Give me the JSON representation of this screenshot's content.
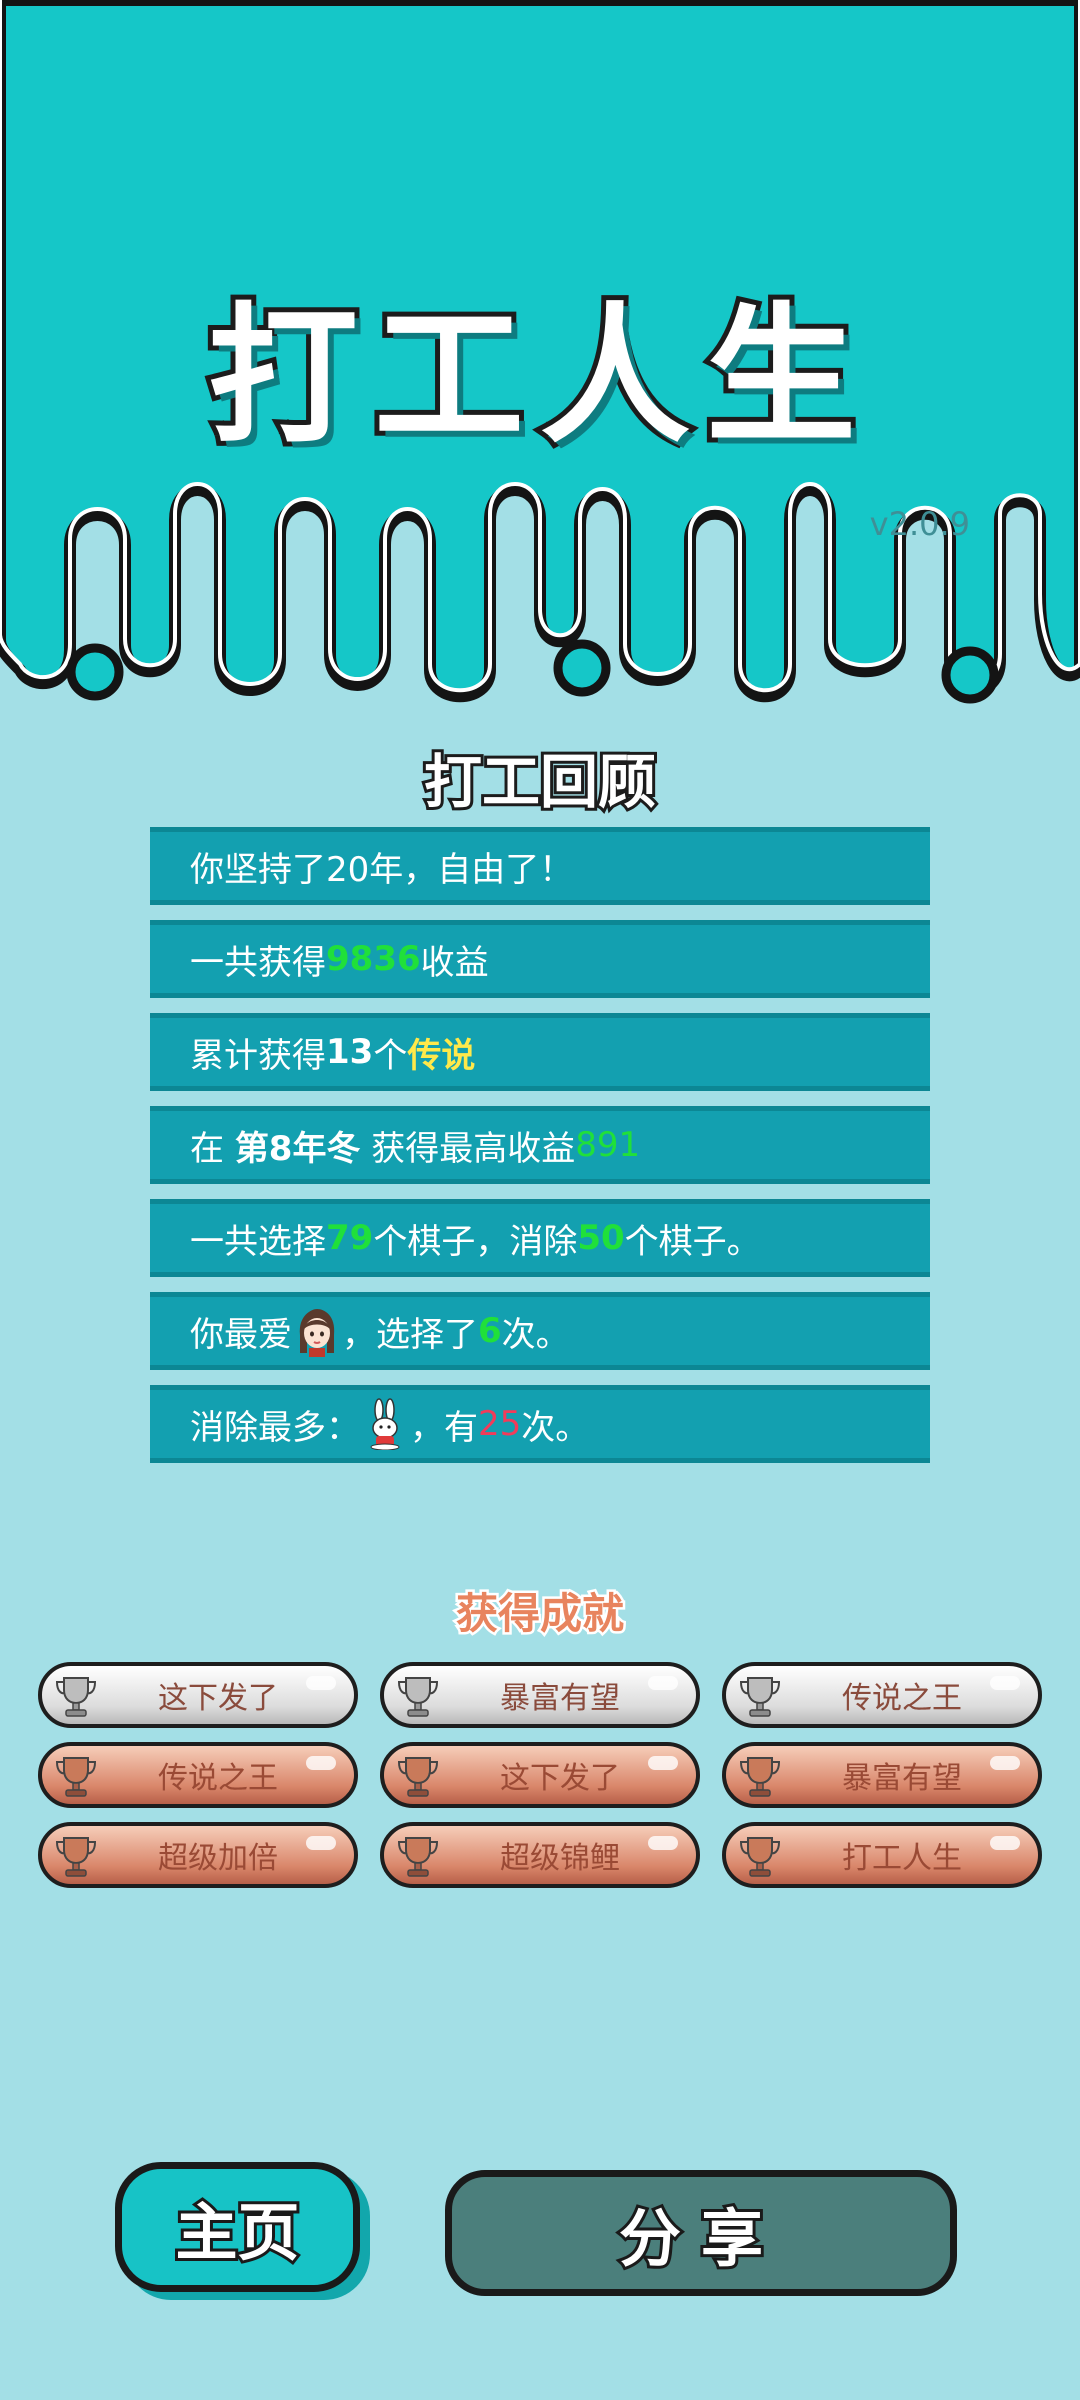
{
  "header": {
    "title": "打工人生",
    "version": "v2.0.9"
  },
  "review": {
    "title": "打工回顾",
    "rows": [
      {
        "p1": "你坚持了20年，自由了！"
      },
      {
        "p1": "一共获得",
        "income": "9836",
        "p2": "收益"
      },
      {
        "p1": "累计获得",
        "count": "13",
        "p2": "个",
        "legend": "传说"
      },
      {
        "p1": "在 ",
        "season": "第8年冬",
        "p2": " 获得最高收益",
        "best": "891"
      },
      {
        "p1": "一共选择",
        "chosen": "79",
        "p2": "个棋子，消除",
        "removed": "50",
        "p3": "个棋子。"
      },
      {
        "p1": "你最爱",
        "avatar": "girl-avatar-icon",
        "p2": "，选择了",
        "times": "6",
        "p3": "次。"
      },
      {
        "p1": "消除最多：",
        "avatar": "rabbit-icon",
        "p2": "，有",
        "times": "25",
        "p3": "次。"
      }
    ]
  },
  "achievements": {
    "title": "获得成就",
    "items": [
      {
        "label": "这下发了",
        "tier": "silver"
      },
      {
        "label": "暴富有望",
        "tier": "silver"
      },
      {
        "label": "传说之王",
        "tier": "silver"
      },
      {
        "label": "传说之王",
        "tier": "bronze"
      },
      {
        "label": "这下发了",
        "tier": "bronze"
      },
      {
        "label": "暴富有望",
        "tier": "bronze"
      },
      {
        "label": "超级加倍",
        "tier": "bronze"
      },
      {
        "label": "超级锦鲤",
        "tier": "bronze"
      },
      {
        "label": "打工人生",
        "tier": "bronze"
      }
    ]
  },
  "buttons": {
    "home": "主页",
    "share": "分享"
  },
  "colors": {
    "top_background": "#15c7c8",
    "page_background": "#a3dfe6",
    "row_background": "#13a0b0",
    "highlight_green": "#20e03a",
    "highlight_yellow": "#ffe94a",
    "highlight_red": "#f23b5a"
  }
}
